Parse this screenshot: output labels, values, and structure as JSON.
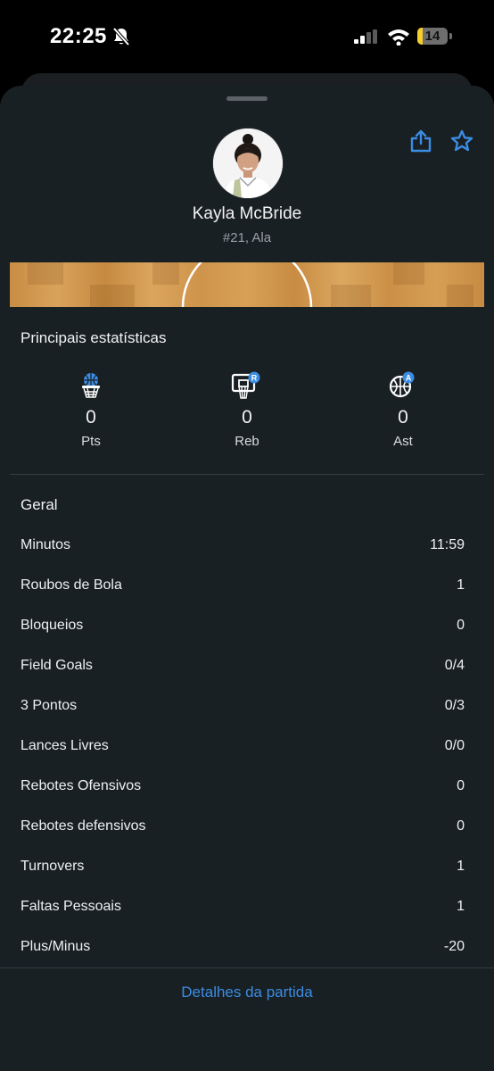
{
  "status_bar": {
    "time": "22:25",
    "battery": "14",
    "battery_color": "#f6cf2c",
    "icons": [
      "bell-slash-icon",
      "signal-icon",
      "wifi-icon",
      "battery-icon"
    ]
  },
  "header": {
    "share_icon": "share-icon",
    "favorite_icon": "star-icon",
    "accent_color": "#3b8ce3"
  },
  "player": {
    "name": "Kayla McBride",
    "subtitle": "#21, Ala"
  },
  "key_stats": {
    "title": "Principais estatísticas",
    "items": [
      {
        "icon": "basketball-hoop-icon",
        "value": "0",
        "label": "Pts"
      },
      {
        "icon": "rebound-icon",
        "badge": "R",
        "value": "0",
        "label": "Reb"
      },
      {
        "icon": "basketball-assist-icon",
        "badge": "A",
        "value": "0",
        "label": "Ast"
      }
    ]
  },
  "general": {
    "title": "Geral",
    "rows": [
      {
        "label": "Minutos",
        "value": "11:59"
      },
      {
        "label": "Roubos de Bola",
        "value": "1"
      },
      {
        "label": "Bloqueios",
        "value": "0"
      },
      {
        "label": "Field Goals",
        "value": "0/4"
      },
      {
        "label": "3 Pontos",
        "value": "0/3"
      },
      {
        "label": "Lances Livres",
        "value": "0/0"
      },
      {
        "label": "Rebotes Ofensivos",
        "value": "0"
      },
      {
        "label": "Rebotes defensivos",
        "value": "0"
      },
      {
        "label": "Turnovers",
        "value": "1"
      },
      {
        "label": "Faltas Pessoais",
        "value": "1"
      },
      {
        "label": "Plus/Minus",
        "value": "-20"
      }
    ]
  },
  "footer": {
    "details_link": "Detalhes da partida"
  }
}
